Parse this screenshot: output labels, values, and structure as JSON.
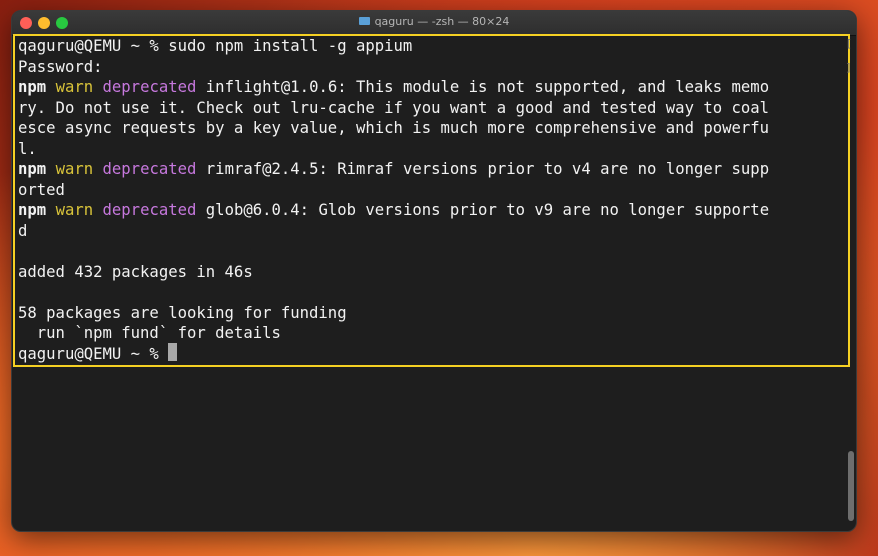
{
  "window": {
    "title": "qaguru — -zsh — 80×24"
  },
  "terminal": {
    "lines": [
      [
        {
          "t": "qaguru@QEMU ~ % sudo npm install -g appium",
          "c": "plain"
        }
      ],
      [
        {
          "t": "Password:",
          "c": "plain"
        }
      ],
      [
        {
          "t": "npm",
          "c": "bold"
        },
        {
          "t": " ",
          "c": "plain"
        },
        {
          "t": "warn",
          "c": "warn"
        },
        {
          "t": " ",
          "c": "plain"
        },
        {
          "t": "deprecated",
          "c": "depr"
        },
        {
          "t": " inflight@1.0.6: This module is not supported, and leaks memo",
          "c": "plain"
        }
      ],
      [
        {
          "t": "ry. Do not use it. Check out lru-cache if you want a good and tested way to coal",
          "c": "plain"
        }
      ],
      [
        {
          "t": "esce async requests by a key value, which is much more comprehensive and powerfu",
          "c": "plain"
        }
      ],
      [
        {
          "t": "l.",
          "c": "plain"
        }
      ],
      [
        {
          "t": "npm",
          "c": "bold"
        },
        {
          "t": " ",
          "c": "plain"
        },
        {
          "t": "warn",
          "c": "warn"
        },
        {
          "t": " ",
          "c": "plain"
        },
        {
          "t": "deprecated",
          "c": "depr"
        },
        {
          "t": " rimraf@2.4.5: Rimraf versions prior to v4 are no longer supp",
          "c": "plain"
        }
      ],
      [
        {
          "t": "orted",
          "c": "plain"
        }
      ],
      [
        {
          "t": "npm",
          "c": "bold"
        },
        {
          "t": " ",
          "c": "plain"
        },
        {
          "t": "warn",
          "c": "warn"
        },
        {
          "t": " ",
          "c": "plain"
        },
        {
          "t": "deprecated",
          "c": "depr"
        },
        {
          "t": " glob@6.0.4: Glob versions prior to v9 are no longer supporte",
          "c": "plain"
        }
      ],
      [
        {
          "t": "d",
          "c": "plain"
        }
      ],
      [
        {
          "t": "",
          "c": "plain"
        }
      ],
      [
        {
          "t": "added 432 packages in 46s",
          "c": "plain"
        }
      ],
      [
        {
          "t": "",
          "c": "plain"
        }
      ],
      [
        {
          "t": "58 packages are looking for funding",
          "c": "plain"
        }
      ],
      [
        {
          "t": "  run `npm fund` for details",
          "c": "plain"
        }
      ]
    ],
    "prompt": "qaguru@QEMU ~ % "
  },
  "colors": {
    "warn": "#d9c43a",
    "deprecated": "#c678dd",
    "highlight_border": "#f5d023",
    "background": "#1e1e1e"
  },
  "icons": {
    "close": "close-icon",
    "minimize": "minimize-icon",
    "maximize": "maximize-icon",
    "folder": "folder-icon",
    "cursor": "cursor-block"
  }
}
